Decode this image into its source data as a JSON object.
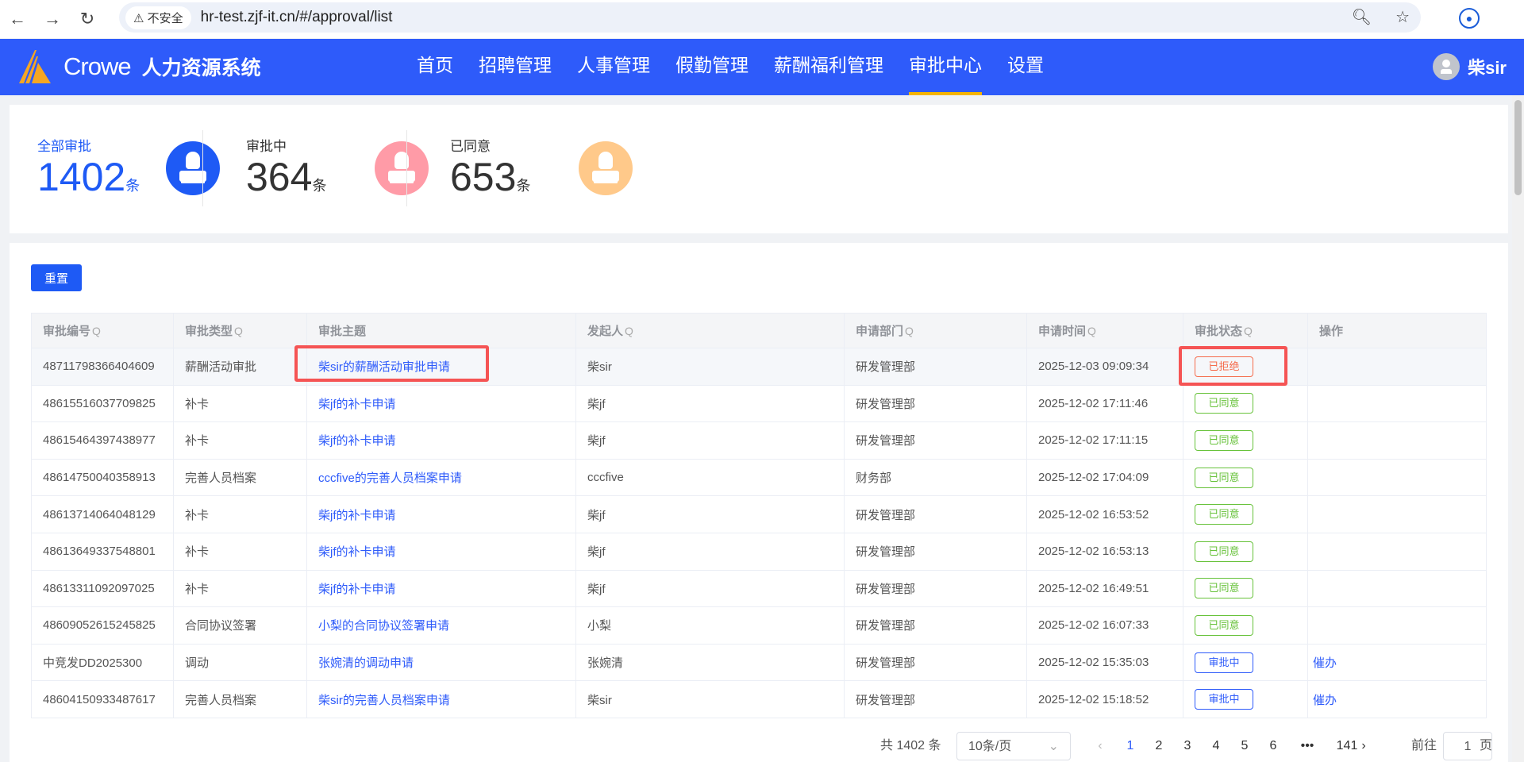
{
  "browser": {
    "security": "不安全",
    "url": "hr-test.zjf-it.cn/#/approval/list"
  },
  "header": {
    "brand": "Crowe",
    "system": "人力资源系统",
    "nav": [
      "首页",
      "招聘管理",
      "人事管理",
      "假勤管理",
      "薪酬福利管理",
      "审批中心",
      "设置"
    ],
    "active": 5,
    "user": "柴sir"
  },
  "stats": [
    {
      "label": "全部审批",
      "value": "1402",
      "unit": "条",
      "color": "#1e5af5"
    },
    {
      "label": "审批中",
      "value": "364",
      "unit": "条",
      "color": "#ff9ba7"
    },
    {
      "label": "已同意",
      "value": "653",
      "unit": "条",
      "color": "#ffc98a"
    }
  ],
  "toolbar": {
    "reset": "重置"
  },
  "table": {
    "headers": [
      "审批编号",
      "审批类型",
      "审批主题",
      "发起人",
      "申请部门",
      "申请时间",
      "审批状态",
      "操作"
    ],
    "rows": [
      [
        "48711798366404609",
        "薪酬活动审批",
        "柴sir的薪酬活动审批申请",
        "柴sir",
        "研发管理部",
        "2025-12-03 09:09:34",
        "已拒绝",
        ""
      ],
      [
        "48615516037709825",
        "补卡",
        "柴jf的补卡申请",
        "柴jf",
        "研发管理部",
        "2025-12-02 17:11:46",
        "已同意",
        ""
      ],
      [
        "48615464397438977",
        "补卡",
        "柴jf的补卡申请",
        "柴jf",
        "研发管理部",
        "2025-12-02 17:11:15",
        "已同意",
        ""
      ],
      [
        "48614750040358913",
        "完善人员档案",
        "cccfive的完善人员档案申请",
        "cccfive",
        "财务部",
        "2025-12-02 17:04:09",
        "已同意",
        ""
      ],
      [
        "48613714064048129",
        "补卡",
        "柴jf的补卡申请",
        "柴jf",
        "研发管理部",
        "2025-12-02 16:53:52",
        "已同意",
        ""
      ],
      [
        "48613649337548801",
        "补卡",
        "柴jf的补卡申请",
        "柴jf",
        "研发管理部",
        "2025-12-02 16:53:13",
        "已同意",
        ""
      ],
      [
        "48613311092097025",
        "补卡",
        "柴jf的补卡申请",
        "柴jf",
        "研发管理部",
        "2025-12-02 16:49:51",
        "已同意",
        ""
      ],
      [
        "48609052615245825",
        "合同协议签署",
        "小梨的合同协议签署申请",
        "小梨",
        "研发管理部",
        "2025-12-02 16:07:33",
        "已同意",
        ""
      ],
      [
        "中竞发DD2025300",
        "调动",
        "张婉清的调动申请",
        "张婉清",
        "研发管理部",
        "2025-12-02 15:35:03",
        "审批中",
        "催办"
      ],
      [
        "48604150933487617",
        "完善人员档案",
        "柴sir的完善人员档案申请",
        "柴sir",
        "研发管理部",
        "2025-12-02 15:18:52",
        "审批中",
        "催办"
      ]
    ]
  },
  "status_colors": {
    "已拒绝": "#f56c4c",
    "已同意": "#67c23a",
    "审批中": "#2e5bfa"
  },
  "pagination": {
    "total": "共 1402 条",
    "page_size": "10条/页",
    "pages": [
      "1",
      "2",
      "3",
      "4",
      "5",
      "6",
      "•••",
      "141"
    ],
    "current": "1",
    "goto_label": "前往",
    "goto_value": "1",
    "page_suffix": "页"
  }
}
